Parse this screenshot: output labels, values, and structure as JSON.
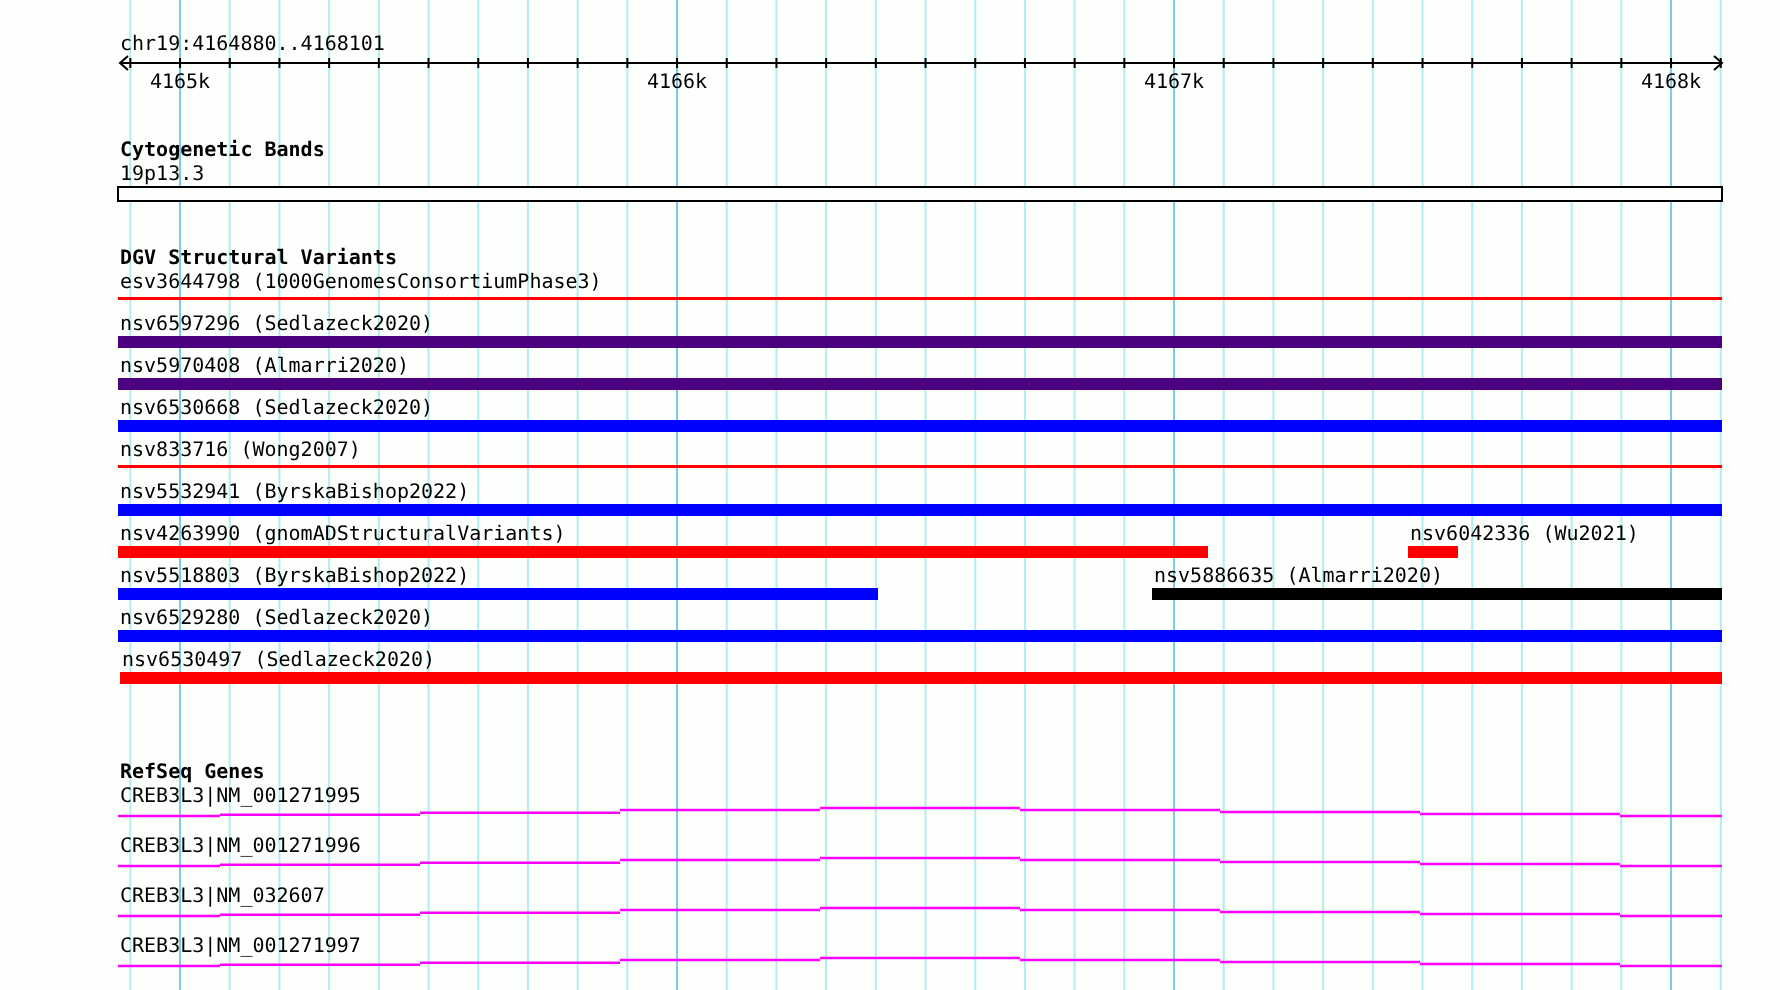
{
  "location": "chr19:4164880..4168101",
  "ruler": {
    "ticks": [
      "4165k",
      "4166k",
      "4167k",
      "4168k"
    ]
  },
  "cytogenetic_bands": {
    "title": "Cytogenetic Bands",
    "band": "19p13.3"
  },
  "dgv": {
    "title": "DGV Structural Variants",
    "rows": [
      {
        "variants": [
          {
            "label": "esv3644798 (1000GenomesConsortiumPhase3)",
            "kind": "line",
            "color": "#ff0000"
          }
        ]
      },
      {
        "variants": [
          {
            "label": "nsv6597296 (Sedlazeck2020)",
            "kind": "bar",
            "color": "#4b0082"
          }
        ]
      },
      {
        "variants": [
          {
            "label": "nsv5970408 (Almarri2020)",
            "kind": "bar",
            "color": "#4b0082"
          }
        ]
      },
      {
        "variants": [
          {
            "label": "nsv6530668 (Sedlazeck2020)",
            "kind": "bar",
            "color": "#0000ff"
          }
        ]
      },
      {
        "variants": [
          {
            "label": "nsv833716 (Wong2007)",
            "kind": "line",
            "color": "#ff0000"
          }
        ]
      },
      {
        "variants": [
          {
            "label": "nsv5532941 (ByrskaBishop2022)",
            "kind": "bar",
            "color": "#0000ff"
          }
        ]
      },
      {
        "variants": [
          {
            "label": "nsv4263990 (gnomADStructuralVariants)",
            "kind": "bar",
            "color": "#ff0000"
          },
          {
            "label": "nsv6042336 (Wu2021)",
            "kind": "bar",
            "color": "#ff0000"
          }
        ]
      },
      {
        "variants": [
          {
            "label": "nsv5518803 (ByrskaBishop2022)",
            "kind": "bar",
            "color": "#0000ff"
          },
          {
            "label": "nsv5886635 (Almarri2020)",
            "kind": "bar",
            "color": "#000000"
          }
        ]
      },
      {
        "variants": [
          {
            "label": "nsv6529280 (Sedlazeck2020)",
            "kind": "bar",
            "color": "#0000ff"
          }
        ]
      },
      {
        "variants": [
          {
            "label": "nsv6530497 (Sedlazeck2020)",
            "kind": "bar",
            "color": "#ff0000"
          }
        ]
      }
    ]
  },
  "refseq": {
    "title": "RefSeq Genes",
    "transcripts": [
      "CREB3L3|NM_001271995",
      "CREB3L3|NM_001271996",
      "CREB3L3|NM_032607",
      "CREB3L3|NM_001271997"
    ]
  }
}
